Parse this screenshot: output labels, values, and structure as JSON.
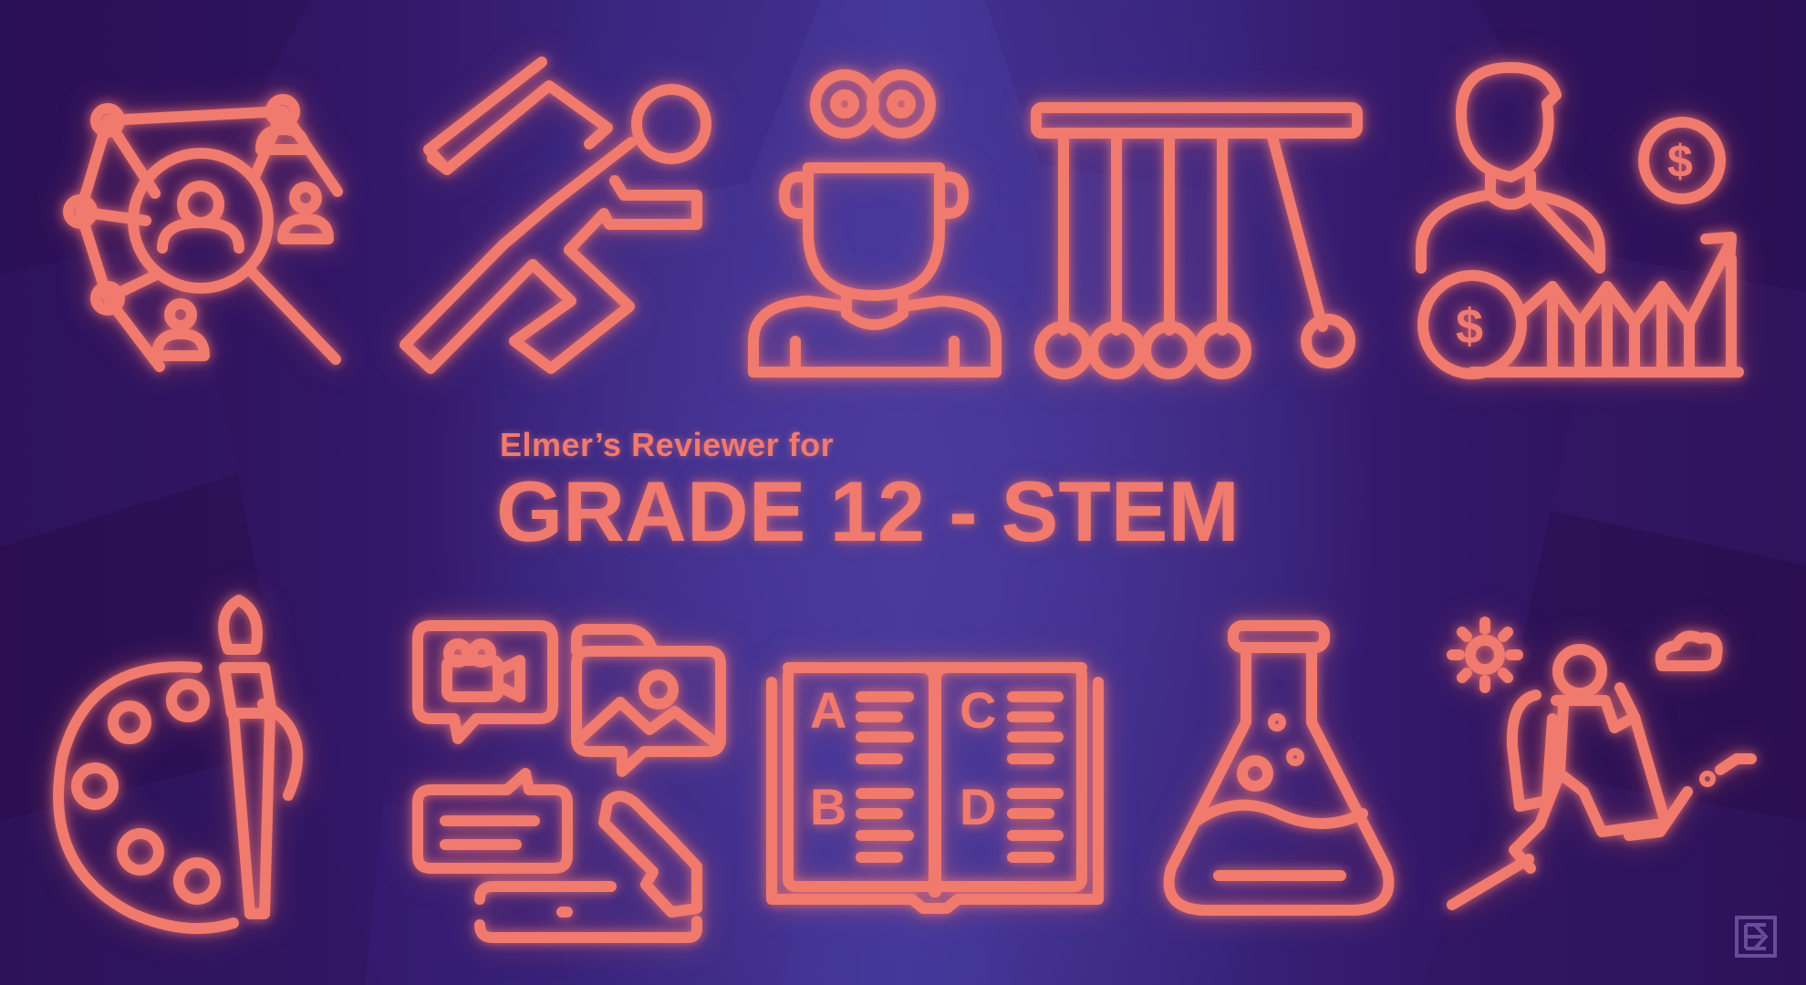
{
  "page": {
    "subtitle": "Elmer’s Reviewer for",
    "title": "GRADE 12 - STEM"
  },
  "colors": {
    "background_dark": "#2a0f52",
    "background_center": "#44379a",
    "icon_stroke": "#f07a6e"
  },
  "icons": {
    "top_row": [
      "network-search-people-icon",
      "running-person-icon",
      "thinking-person-icon",
      "newtons-cradle-icon",
      "businessman-finance-growth-icon"
    ],
    "bottom_row": [
      "paint-palette-brush-icon",
      "social-media-chat-icon",
      "open-book-abcd-icon",
      "laboratory-flask-icon",
      "hiker-climbing-icon"
    ]
  }
}
